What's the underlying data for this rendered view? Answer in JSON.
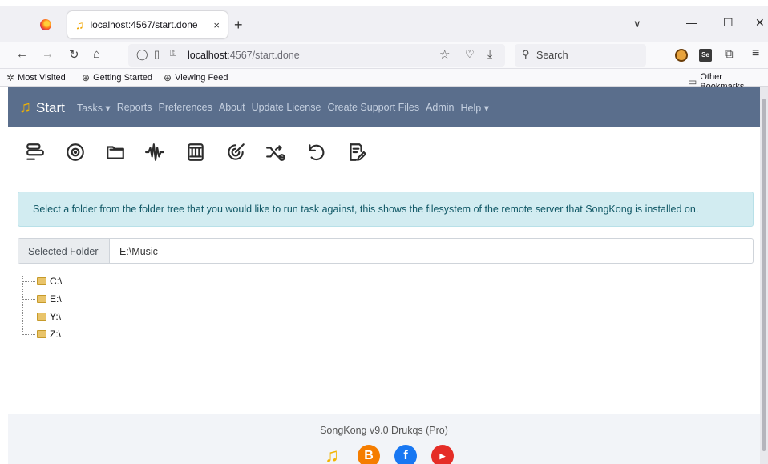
{
  "browser": {
    "tab_title": "localhost:4567/start.done",
    "tab_close": "×",
    "new_tab": "+",
    "list_tabs": "∨",
    "minimize": "—",
    "maximize": "☐",
    "close": "✕",
    "url_host": "localhost",
    "url_rest": ":4567/start.done",
    "search_placeholder": "Search",
    "bookmarks": [
      "Most Visited",
      "Getting Started",
      "Viewing Feed"
    ],
    "other_bookmarks": "Other Bookmarks"
  },
  "app": {
    "brand": "Start",
    "nav": [
      "Tasks ▾",
      "Reports",
      "Preferences",
      "About",
      "Update License",
      "Create Support Files",
      "Admin",
      "Help ▾"
    ],
    "toolbar_icons": [
      "align-left-icon",
      "disc-icon",
      "folder-icon",
      "waveform-icon",
      "film-icon",
      "radar-icon",
      "shuffle-icon",
      "undo-icon",
      "edit-list-icon"
    ],
    "alert": "Select a folder from the folder tree that you would like to run task against, this shows the filesystem of the remote server that SongKong is installed on.",
    "selected_folder_label": "Selected Folder",
    "selected_folder_value": "E:\\Music",
    "tree": [
      "C:\\",
      "E:\\",
      "Y:\\",
      "Z:\\"
    ],
    "footer": "SongKong v9.0 Drukqs (Pro)"
  },
  "colors": {
    "header_bg": "#5a6e8c",
    "alert_bg": "#d2ecf1",
    "accent": "#f3b400"
  }
}
